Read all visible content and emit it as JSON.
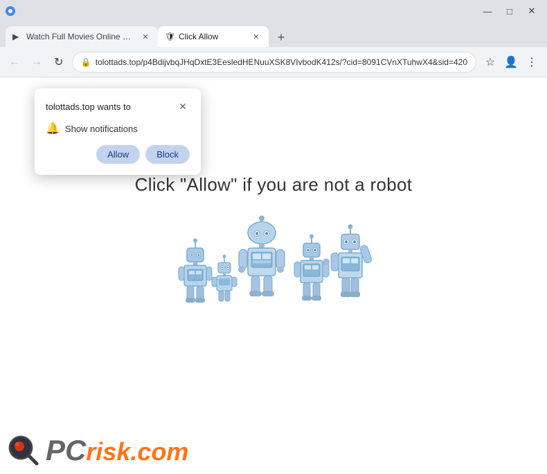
{
  "window": {
    "controls": {
      "minimize": "—",
      "maximize": "□",
      "close": "✕"
    }
  },
  "tabs": [
    {
      "id": "tab1",
      "label": "Watch Full Movies Online Free ...",
      "active": false,
      "favicon": "▶"
    },
    {
      "id": "tab2",
      "label": "Click Allow",
      "active": true,
      "favicon": "🛡"
    }
  ],
  "tab_new_label": "+",
  "toolbar": {
    "back_label": "←",
    "forward_label": "→",
    "reload_label": "↻",
    "address": "tolottads.top/p4BdijvbqJHqDxtE3EesledHENuuXSK8VIvbodK412s/?cid=8091CVnXTuhwX4&sid=420",
    "bookmark_label": "☆",
    "profile_label": "👤",
    "menu_label": "⋮"
  },
  "popup": {
    "title": "tolottads.top wants to",
    "close_label": "✕",
    "permission": {
      "icon": "🔔",
      "text": "Show notifications"
    },
    "buttons": {
      "allow": "Allow",
      "block": "Block"
    }
  },
  "page": {
    "main_text": "Click \"Allow\"  if you are not   a robot"
  },
  "watermark": {
    "pc_text": "PC",
    "risk_text": "risk.com"
  }
}
